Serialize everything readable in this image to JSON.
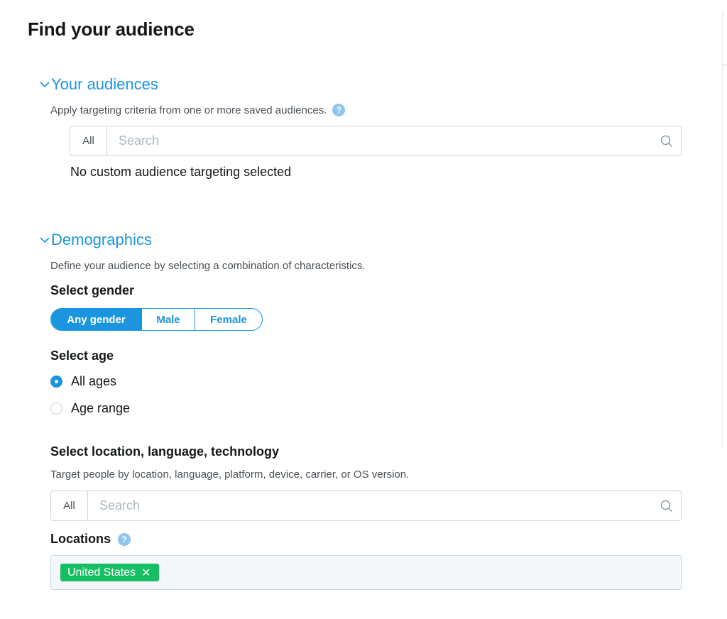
{
  "page": {
    "title": "Find your audience"
  },
  "your_audiences": {
    "header": "Your audiences",
    "description": "Apply targeting criteria from one or more saved audiences.",
    "help_icon": "?",
    "search": {
      "scope": "All",
      "placeholder": "Search"
    },
    "empty_state": "No custom audience targeting selected"
  },
  "demographics": {
    "header": "Demographics",
    "description": "Define your audience by selecting a combination of characteristics.",
    "gender": {
      "label": "Select gender",
      "options": [
        "Any gender",
        "Male",
        "Female"
      ],
      "selected": "Any gender"
    },
    "age": {
      "label": "Select age",
      "options": [
        "All ages",
        "Age range"
      ],
      "selected": "All ages"
    },
    "location": {
      "label": "Select location, language, technology",
      "description": "Target people by location, language, platform, device, carrier, or OS version.",
      "search": {
        "scope": "All",
        "placeholder": "Search"
      },
      "locations_label": "Locations",
      "help_icon": "?",
      "selected_tags": [
        "United States"
      ],
      "remove_glyph": "✕"
    }
  },
  "colors": {
    "accent": "#1b95e0",
    "tag": "#17bf63",
    "text": "#14171a",
    "muted": "#4a5157"
  }
}
